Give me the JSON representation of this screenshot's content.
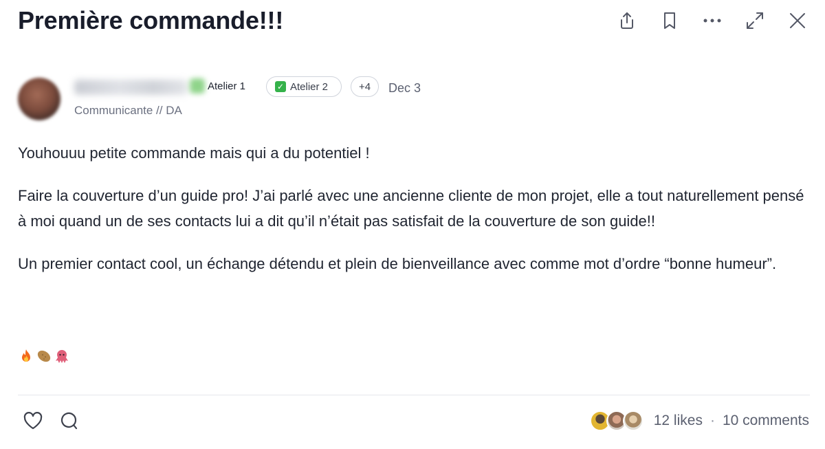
{
  "post": {
    "title": "Première commande!!!",
    "author": {
      "badge_1": "Atelier 1",
      "badge_2": "Atelier 2",
      "badge_more": "+4",
      "date": "Dec 3",
      "role": "Communicante // DA"
    },
    "paragraphs": [
      "Youhouuu petite commande mais qui a du potentiel !",
      "Faire la couverture d’un guide pro! J’ai parlé avec une ancienne cliente de mon projet, elle a tout naturellement pensé à moi quand un de ses contacts lui a dit qu’il n’était pas satisfait de la couverture de son guide!!",
      "Un premier contact cool, un échange détendu et plein de bienveillance avec comme mot d’ordre “bonne humeur”."
    ],
    "emojis": [
      "fire-emoji",
      "potato-emoji",
      "octopus-emoji"
    ]
  },
  "toolbar": {
    "icons": [
      "share-icon",
      "bookmark-icon",
      "more-icon",
      "expand-icon",
      "close-icon"
    ]
  },
  "footer": {
    "likes": "12 likes",
    "separator": "·",
    "comments": "10 comments"
  },
  "colors": {
    "title": "#191d2b",
    "text": "#1f2430",
    "muted": "#5b6070",
    "divider": "#e5e7eb",
    "check_green": "#35b24a"
  }
}
